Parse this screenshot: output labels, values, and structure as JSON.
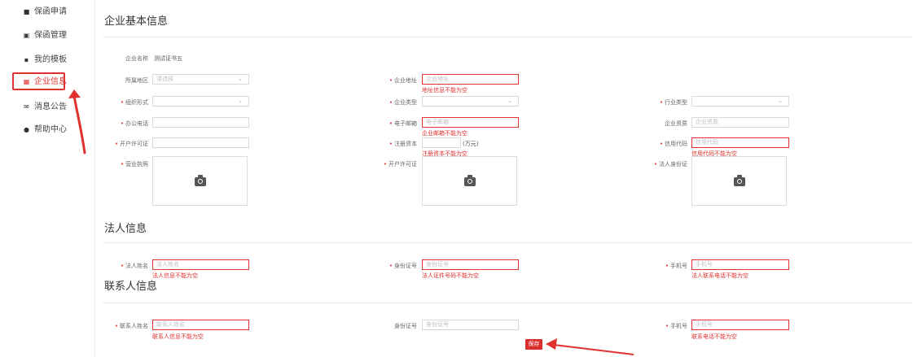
{
  "sidebar": {
    "items": [
      {
        "label": "保函申请",
        "icon": "apply-icon"
      },
      {
        "label": "保函管理",
        "icon": "manage-icon"
      },
      {
        "label": "我的模板",
        "icon": "template-icon"
      },
      {
        "label": "企业信息",
        "icon": "grid-icon",
        "active": true
      },
      {
        "label": "消息公告",
        "icon": "mail-icon"
      },
      {
        "label": "帮助中心",
        "icon": "help-icon"
      }
    ]
  },
  "company": {
    "title": "企业基本信息",
    "name_label": "企业名称",
    "name_value": "测试证书五",
    "region_label": "所属地区",
    "region_placeholder": "请选择",
    "address_label": "企业地址",
    "address_placeholder": "企业地址",
    "address_error": "地址信息不能为空",
    "org_label": "组织形式",
    "type_label": "企业类型",
    "industry_label": "行业类型",
    "phone_label": "办公电话",
    "email_label": "电子邮箱",
    "email_placeholder": "电子邮箱",
    "email_error": "企业邮箱不能为空",
    "quality_label": "企业资质",
    "quality_placeholder": "企业资质",
    "permit_label": "开户许可证",
    "capital_label": "注册资本",
    "capital_unit": "(万元)",
    "capital_error": "注册资本不能为空",
    "credit_label": "信用代码",
    "credit_placeholder": "信用代码",
    "credit_error": "信用代码不能为空",
    "license_label": "营业执照",
    "permit_upload_label": "开户许可证",
    "legal_id_label": "法人身份证"
  },
  "legal": {
    "title": "法人信息",
    "name_label": "法人姓名",
    "name_placeholder": "法人姓名",
    "name_error": "法人信息不能为空",
    "id_label": "身份证号",
    "id_placeholder": "身份证号",
    "id_error": "法人证件号码不能为空",
    "mobile_label": "手机号",
    "mobile_placeholder": "手机号",
    "mobile_error": "法人联系电话不能为空"
  },
  "contact": {
    "title": "联系人信息",
    "name_label": "联系人姓名",
    "name_placeholder": "联系人姓名",
    "name_error": "联系人信息不能为空",
    "id_label": "身份证号",
    "id_placeholder": "身份证号",
    "mobile_label": "手机号",
    "mobile_placeholder": "手机号",
    "mobile_error": "联系电话不能为空"
  },
  "actions": {
    "save_label": "保存"
  },
  "colors": {
    "accent": "#e0312f",
    "border": "#d9d9d9",
    "text": "#555555"
  }
}
